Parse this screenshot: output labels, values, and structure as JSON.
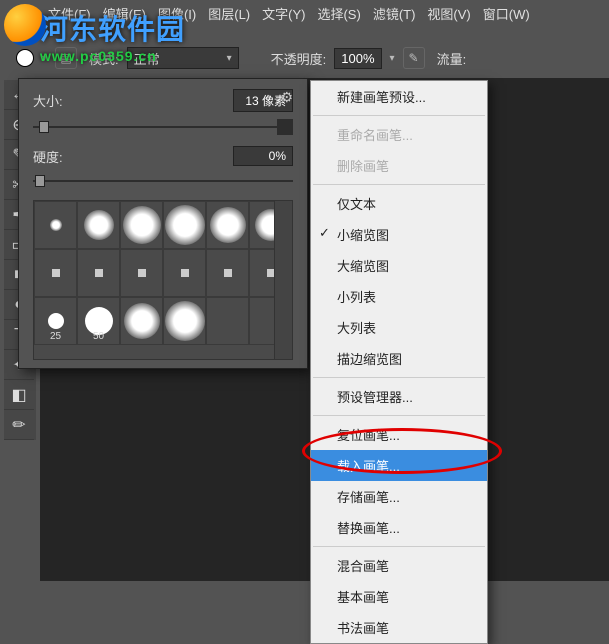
{
  "menu": {
    "file": "文件(F)",
    "edit": "编辑(E)",
    "image": "图像(I)",
    "layer": "图层(L)",
    "type": "文字(Y)",
    "select": "选择(S)",
    "filter": "滤镜(T)",
    "view": "视图(V)",
    "window": "窗口(W)"
  },
  "watermark": {
    "line1": "河东软件园",
    "line2": "www.pc0359.cn"
  },
  "optbar": {
    "mode_label": "模式:",
    "mode_value": "正常",
    "opacity_label": "不透明度:",
    "opacity_value": "100%",
    "flow_label": "流量:"
  },
  "panel": {
    "size_label": "大小:",
    "size_value": "13 像素",
    "hard_label": "硬度:",
    "hard_value": "0%",
    "thumb_nums": [
      "25",
      "50"
    ]
  },
  "tools": [
    "↔",
    "⊕",
    "✎",
    "✂",
    "✒",
    "▭",
    "■",
    "◐",
    "T",
    "✦",
    "◧",
    "✏"
  ],
  "brush_cells": [
    {
      "kind": "soft",
      "d": 12
    },
    {
      "kind": "soft",
      "d": 30
    },
    {
      "kind": "soft",
      "d": 38
    },
    {
      "kind": "soft",
      "d": 40
    },
    {
      "kind": "soft",
      "d": 36
    },
    {
      "kind": "soft",
      "d": 32
    },
    {
      "kind": "tiny"
    },
    {
      "kind": "tiny"
    },
    {
      "kind": "tiny"
    },
    {
      "kind": "tiny"
    },
    {
      "kind": "tiny"
    },
    {
      "kind": "tiny"
    },
    {
      "kind": "hard",
      "d": 16,
      "num": "25"
    },
    {
      "kind": "hard",
      "d": 28,
      "num": "50"
    },
    {
      "kind": "soft",
      "d": 36
    },
    {
      "kind": "soft",
      "d": 40
    },
    {
      "kind": "blank"
    },
    {
      "kind": "blank"
    }
  ],
  "ctx": {
    "new_preset": "新建画笔预设...",
    "rename": "重命名画笔...",
    "delete": "删除画笔",
    "text_only": "仅文本",
    "small_thumb": "小缩览图",
    "large_thumb": "大缩览图",
    "small_list": "小列表",
    "large_list": "大列表",
    "stroke_thumb": "描边缩览图",
    "preset_mgr": "预设管理器...",
    "reset": "复位画笔...",
    "load": "载入画笔...",
    "save": "存储画笔...",
    "replace": "替换画笔...",
    "mixed": "混合画笔",
    "basic": "基本画笔",
    "callig": "书法画笔"
  }
}
